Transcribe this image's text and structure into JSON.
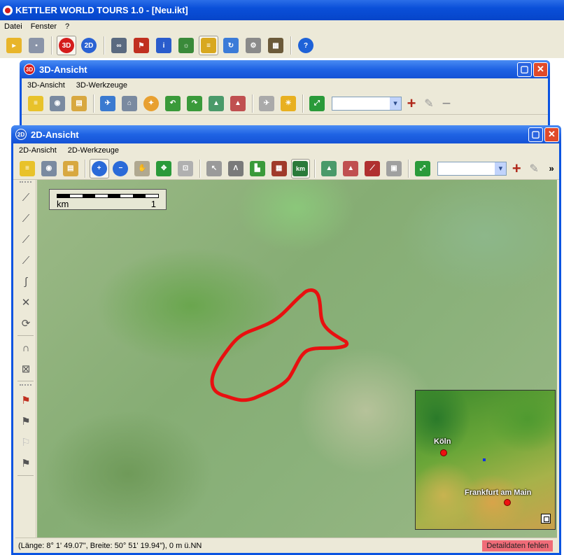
{
  "app": {
    "title": "KETTLER WORLD TOURS 1.0 - [Neu.ikt]"
  },
  "menu": [
    "Datei",
    "Fenster",
    "?"
  ],
  "main_toolbar": {
    "three_d": "3D",
    "two_d": "2D"
  },
  "win3d": {
    "title": "3D-Ansicht",
    "menu": [
      "3D-Ansicht",
      "3D-Werkzeuge"
    ],
    "icon_text": "3D"
  },
  "win2d": {
    "title": "2D-Ansicht",
    "menu": [
      "2D-Ansicht",
      "2D-Werkzeuge"
    ],
    "icon_text": "2D",
    "km_button": "km",
    "more": "»"
  },
  "scale": {
    "unit": "km",
    "value": "1"
  },
  "minimap": {
    "cities": [
      {
        "name": "Köln"
      },
      {
        "name": "Frankfurt am Main"
      }
    ]
  },
  "status": {
    "coords": "(Länge: 8° 1' 49.07\", Breite: 50° 51' 19.94\"), 0 m ü.NN",
    "warning": "Detaildaten fehlen"
  },
  "colors": {
    "route": "#e81010",
    "titlebar": "#0b54e1",
    "warning_bg": "#f06c78"
  }
}
